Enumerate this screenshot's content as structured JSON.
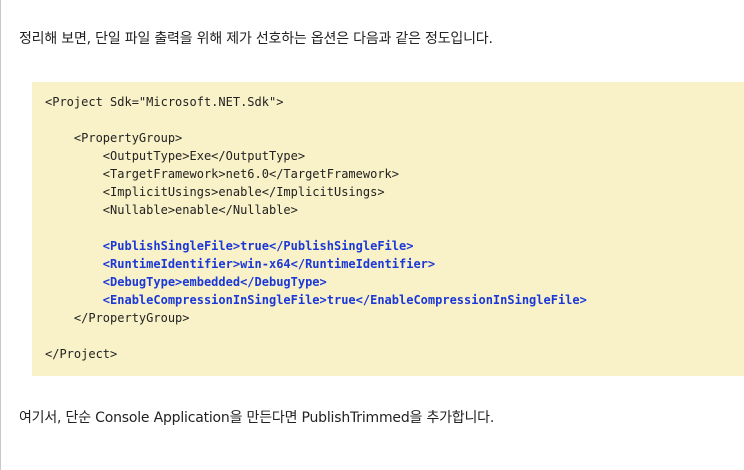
{
  "intro_text": "정리해 보면, 단일 파일 출력을 위해 제가 선호하는 옵션은 다음과 같은 정도입니다.",
  "code": {
    "lines": [
      {
        "text": "<Project Sdk=\"Microsoft.NET.Sdk\">",
        "highlight": false
      },
      {
        "text": "",
        "highlight": false
      },
      {
        "text": "    <PropertyGroup>",
        "highlight": false
      },
      {
        "text": "        <OutputType>Exe</OutputType>",
        "highlight": false
      },
      {
        "text": "        <TargetFramework>net6.0</TargetFramework>",
        "highlight": false
      },
      {
        "text": "        <ImplicitUsings>enable</ImplicitUsings>",
        "highlight": false
      },
      {
        "text": "        <Nullable>enable</Nullable>",
        "highlight": false
      },
      {
        "text": "",
        "highlight": false
      },
      {
        "text": "        <PublishSingleFile>true</PublishSingleFile>",
        "highlight": true
      },
      {
        "text": "        <RuntimeIdentifier>win-x64</RuntimeIdentifier>",
        "highlight": true
      },
      {
        "text": "        <DebugType>embedded</DebugType>",
        "highlight": true
      },
      {
        "text": "        <EnableCompressionInSingleFile>true</EnableCompressionInSingleFile>",
        "highlight": true
      },
      {
        "text": "    </PropertyGroup>",
        "highlight": false
      },
      {
        "text": "",
        "highlight": false
      },
      {
        "text": "</Project>",
        "highlight": false
      }
    ]
  },
  "outro_text": "여기서, 단순 Console Application을 만든다면 PublishTrimmed을 추가합니다.",
  "colors": {
    "code_background": "#f9f1c8",
    "highlight_text": "#1a38d8"
  }
}
